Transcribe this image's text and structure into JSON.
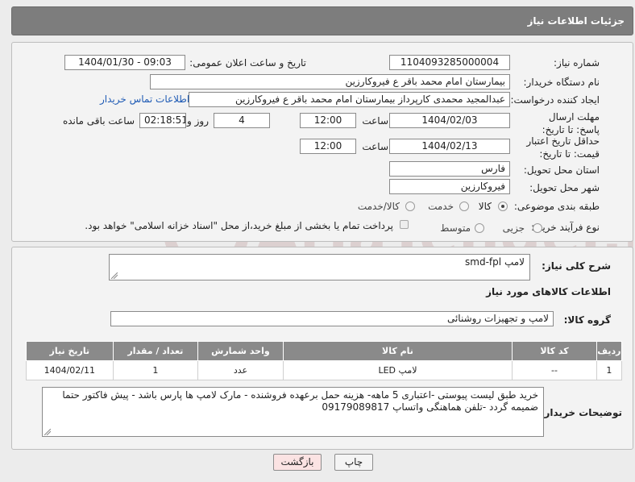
{
  "header": {
    "title": "جزئیات اطلاعات نیاز"
  },
  "labels": {
    "need_number": "شماره نیاز:",
    "announce_datetime": "تاریخ و ساعت اعلان عمومی:",
    "buyer_org": "نام دستگاه خریدار:",
    "requester": "ایجاد کننده درخواست:",
    "reply_deadline": "مهلت ارسال پاسخ: تا تاریخ:",
    "hour": "ساعت",
    "day_and": "روز و",
    "remaining": "ساعت باقی مانده",
    "price_validity": "حداقل تاریخ اعتبار قیمت: تا تاریخ:",
    "delivery_province": "استان محل تحویل:",
    "delivery_city": "شهر محل تحویل:",
    "category": "طبقه بندی موضوعی:",
    "process_type": "نوع فرآیند خرید :",
    "need_description": "شرح کلی نیاز:",
    "goods_info": "اطلاعات کالاهای مورد نیاز",
    "goods_group": "گروه کالا:",
    "buyer_notes": "توضیحات خریدار:"
  },
  "fields": {
    "need_number": "1104093285000004",
    "announce_datetime": "1404/01/30 - 09:03",
    "buyer_org": "بیمارستان امام محمد باقر ع  فیروکارزین",
    "requester": "عبدالمجید محمدی کارپرداز بیمارستان امام محمد باقر ع  فیروکارزین",
    "contact_link": "اطلاعات تماس خریدار",
    "reply_date": "1404/02/03",
    "reply_time": "12:00",
    "reply_days": "4",
    "reply_remaining": "02:18:51",
    "price_date": "1404/02/13",
    "price_time": "12:00",
    "province": "فارس",
    "city": "فیروکارزین",
    "need_description": "لامپ smd-fpl",
    "goods_group": "لامپ و تجهیزات روشنائی",
    "buyer_notes": "خرید طبق لیست پیوستی -اعتباری 5 ماهه- هزینه حمل برعهده فروشنده - مارک لامپ ها پارس باشد - پیش فاکتور حتما ضمیمه گردد -تلفن هماهنگی واتساپ 09179089817"
  },
  "category_options": [
    {
      "label": "کالا",
      "selected": true
    },
    {
      "label": "خدمت",
      "selected": false
    },
    {
      "label": "کالا/خدمت",
      "selected": false
    }
  ],
  "process_options": [
    {
      "label": "جزیی",
      "selected": false
    },
    {
      "label": "متوسط",
      "selected": false
    }
  ],
  "payment_note": "پرداخت تمام یا بخشی از مبلغ خرید،از محل \"اسناد خزانه اسلامی\" خواهد بود.",
  "table": {
    "headers": [
      "ردیف",
      "کد کالا",
      "نام کالا",
      "واحد شمارش",
      "تعداد / مقدار",
      "تاریخ نیاز"
    ],
    "rows": [
      [
        "1",
        "--",
        "لامپ LED",
        "عدد",
        "1",
        "1404/02/11"
      ]
    ]
  },
  "buttons": {
    "print": "چاپ",
    "back": "بازگشت"
  },
  "watermark": "AriaTender.neT",
  "colors": {
    "header_bg": "#7d7d7d",
    "table_header_bg": "#8a8a8a",
    "link": "#1f5bb5",
    "back_btn_bg": "#fbe3e3"
  }
}
